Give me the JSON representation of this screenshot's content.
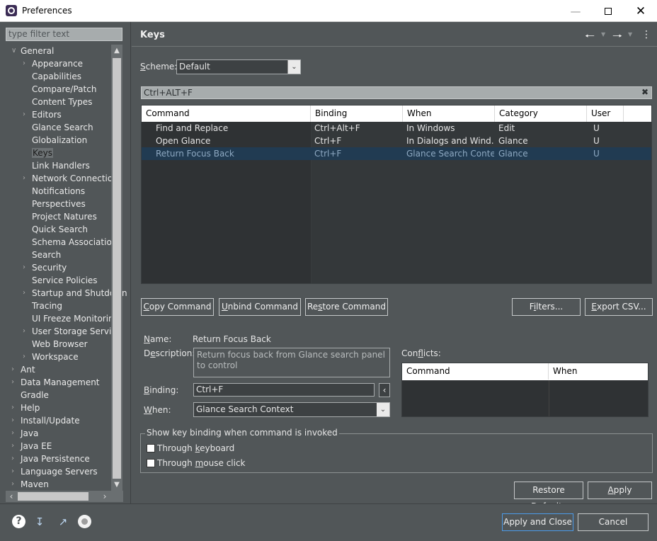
{
  "window": {
    "title": "Preferences"
  },
  "nav": {
    "filter_placeholder": "type filter text",
    "items": [
      {
        "label": "General",
        "level": 0,
        "expanded": true
      },
      {
        "label": "Appearance",
        "level": 1,
        "expandable": true
      },
      {
        "label": "Capabilities",
        "level": 1
      },
      {
        "label": "Compare/Patch",
        "level": 1
      },
      {
        "label": "Content Types",
        "level": 1
      },
      {
        "label": "Editors",
        "level": 1,
        "expandable": true
      },
      {
        "label": "Glance Search",
        "level": 1
      },
      {
        "label": "Globalization",
        "level": 1
      },
      {
        "label": "Keys",
        "level": 1,
        "selected": true
      },
      {
        "label": "Link Handlers",
        "level": 1
      },
      {
        "label": "Network Connection",
        "level": 1,
        "expandable": true
      },
      {
        "label": "Notifications",
        "level": 1
      },
      {
        "label": "Perspectives",
        "level": 1
      },
      {
        "label": "Project Natures",
        "level": 1
      },
      {
        "label": "Quick Search",
        "level": 1
      },
      {
        "label": "Schema Associations",
        "level": 1
      },
      {
        "label": "Search",
        "level": 1
      },
      {
        "label": "Security",
        "level": 1,
        "expandable": true
      },
      {
        "label": "Service Policies",
        "level": 1
      },
      {
        "label": "Startup and Shutdown",
        "level": 1,
        "expandable": true
      },
      {
        "label": "Tracing",
        "level": 1
      },
      {
        "label": "UI Freeze Monitoring",
        "level": 1
      },
      {
        "label": "User Storage Service",
        "level": 1,
        "expandable": true
      },
      {
        "label": "Web Browser",
        "level": 1
      },
      {
        "label": "Workspace",
        "level": 1,
        "expandable": true
      },
      {
        "label": "Ant",
        "level": 0,
        "expandable": true
      },
      {
        "label": "Data Management",
        "level": 0,
        "expandable": true
      },
      {
        "label": "Gradle",
        "level": 0
      },
      {
        "label": "Help",
        "level": 0,
        "expandable": true
      },
      {
        "label": "Install/Update",
        "level": 0,
        "expandable": true
      },
      {
        "label": "Java",
        "level": 0,
        "expandable": true
      },
      {
        "label": "Java EE",
        "level": 0,
        "expandable": true
      },
      {
        "label": "Java Persistence",
        "level": 0,
        "expandable": true
      },
      {
        "label": "Language Servers",
        "level": 0,
        "expandable": true
      },
      {
        "label": "Maven",
        "level": 0,
        "expandable": true
      }
    ]
  },
  "page": {
    "title": "Keys",
    "scheme_label": "Scheme:",
    "scheme_value": "Default",
    "search_value": "Ctrl+ALT+F",
    "table": {
      "columns": [
        "Command",
        "Binding",
        "When",
        "Category",
        "User"
      ],
      "rows": [
        {
          "command": "Find and Replace",
          "binding": "Ctrl+Alt+F",
          "when": "In Windows",
          "category": "Edit",
          "user": "U"
        },
        {
          "command": "Open Glance",
          "binding": "Ctrl+F",
          "when": "In Dialogs and Wind...",
          "category": "Glance",
          "user": "U"
        },
        {
          "command": "Return Focus Back",
          "binding": "Ctrl+F",
          "when": "Glance Search Context",
          "category": "Glance",
          "user": "U",
          "selected": true
        }
      ]
    },
    "buttons": {
      "copy": "Copy Command",
      "unbind": "Unbind Command",
      "restore": "Restore Command",
      "filters": "Filters...",
      "export": "Export CSV..."
    },
    "details": {
      "name_label": "Name:",
      "name_value": "Return Focus Back",
      "description_label": "Description:",
      "description_value": "Return focus back from Glance search panel to control",
      "binding_label": "Binding:",
      "binding_value": "Ctrl+F",
      "when_label": "When:",
      "when_value": "Glance Search Context"
    },
    "conflicts": {
      "label": "Conflicts:",
      "columns": [
        "Command",
        "When"
      ]
    },
    "group": {
      "legend": "Show key binding when command is invoked",
      "keyboard": "Through keyboard",
      "mouse": "Through mouse click"
    },
    "restore_defaults": "Restore Defaults",
    "apply": "Apply"
  },
  "footer": {
    "apply_close": "Apply and Close",
    "cancel": "Cancel",
    "icons": [
      "help-icon",
      "import-icon",
      "export-icon",
      "record-icon"
    ]
  }
}
